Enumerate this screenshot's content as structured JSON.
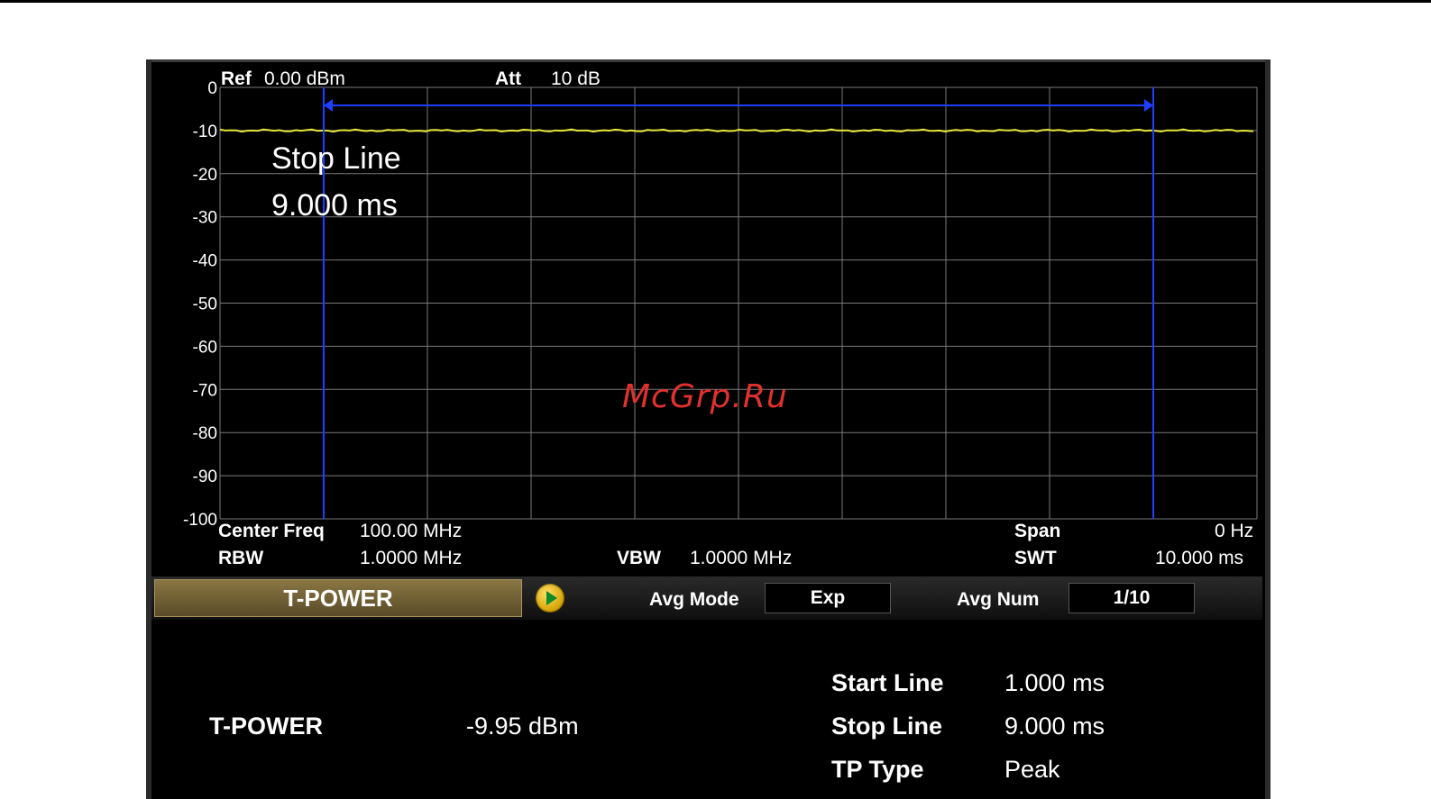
{
  "header": {
    "ref_label": "Ref",
    "ref_value": "0.00 dBm",
    "att_label": "Att",
    "att_value": "10 dB"
  },
  "plot": {
    "y_ticks": [
      "0",
      "-10",
      "-20",
      "-30",
      "-40",
      "-50",
      "-60",
      "-70",
      "-80",
      "-90",
      "-100"
    ],
    "trace_level_dbm": -10,
    "trace_color": "#e6e63a",
    "marker_color": "#1f3fff",
    "grid_color": "#7a7a7a",
    "start_line_ms": 1.0,
    "stop_line_ms": 9.0,
    "sweep_ms": 10.0,
    "annotation_title": "Stop Line",
    "annotation_value": "9.000 ms"
  },
  "footer": {
    "center_freq_label": "Center Freq",
    "center_freq_value": "100.00 MHz",
    "span_label": "Span",
    "span_value": "0 Hz",
    "rbw_label": "RBW",
    "rbw_value": "1.0000 MHz",
    "vbw_label": "VBW",
    "vbw_value": "1.0000 MHz",
    "swt_label": "SWT",
    "swt_value": "10.000 ms"
  },
  "controls": {
    "mode_label": "T-POWER",
    "avg_mode_label": "Avg Mode",
    "avg_mode_value": "Exp",
    "avg_num_label": "Avg Num",
    "avg_num_value": "1/10"
  },
  "results": {
    "tpower_label": "T-POWER",
    "tpower_value": "-9.95 dBm",
    "start_line_label": "Start Line",
    "start_line_value": "1.000 ms",
    "stop_line_label": "Stop Line",
    "stop_line_value": "9.000 ms",
    "tp_type_label": "TP Type",
    "tp_type_value": "Peak"
  },
  "watermark": "McGrp.Ru"
}
